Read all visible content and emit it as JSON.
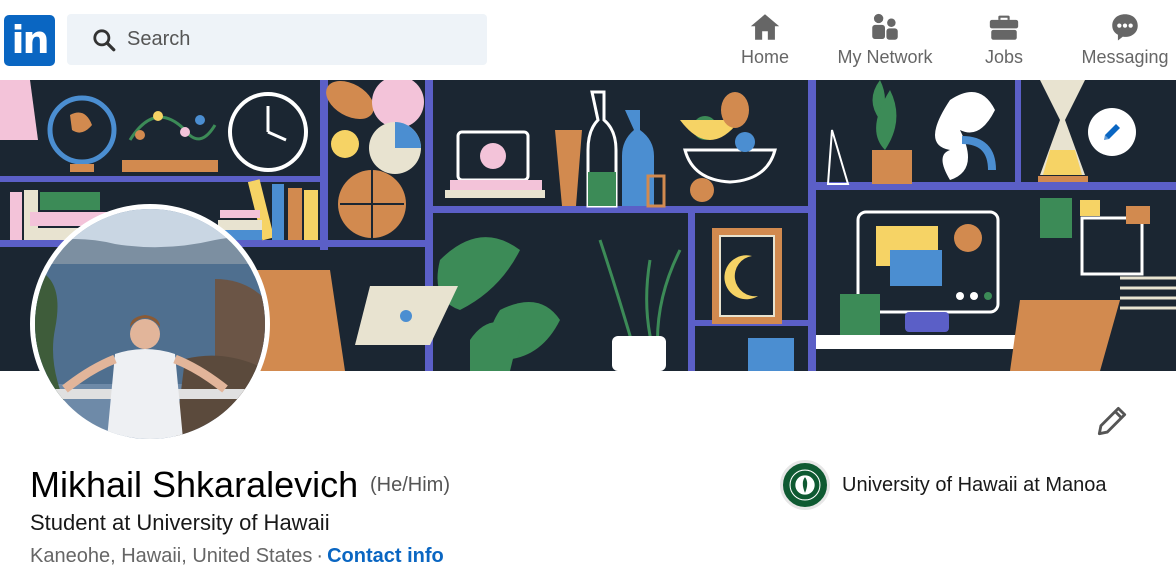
{
  "header": {
    "logo_text": "in",
    "search_placeholder": "Search",
    "nav": [
      {
        "label": "Home",
        "icon": "home-icon"
      },
      {
        "label": "My Network",
        "icon": "network-icon"
      },
      {
        "label": "Jobs",
        "icon": "briefcase-icon"
      },
      {
        "label": "Messaging",
        "icon": "messaging-icon"
      }
    ]
  },
  "profile": {
    "name": "Mikhail Shkaralevich",
    "pronouns": "(He/Him)",
    "headline": "Student at University of Hawaii",
    "location": "Kaneohe, Hawaii, United States",
    "separator": "·",
    "contact_label": "Contact info",
    "education": "University of Hawaii at Manoa"
  },
  "colors": {
    "brand": "#0a66c2",
    "banner_bg": "#1b2632",
    "shelf": "#5b5fc7"
  }
}
